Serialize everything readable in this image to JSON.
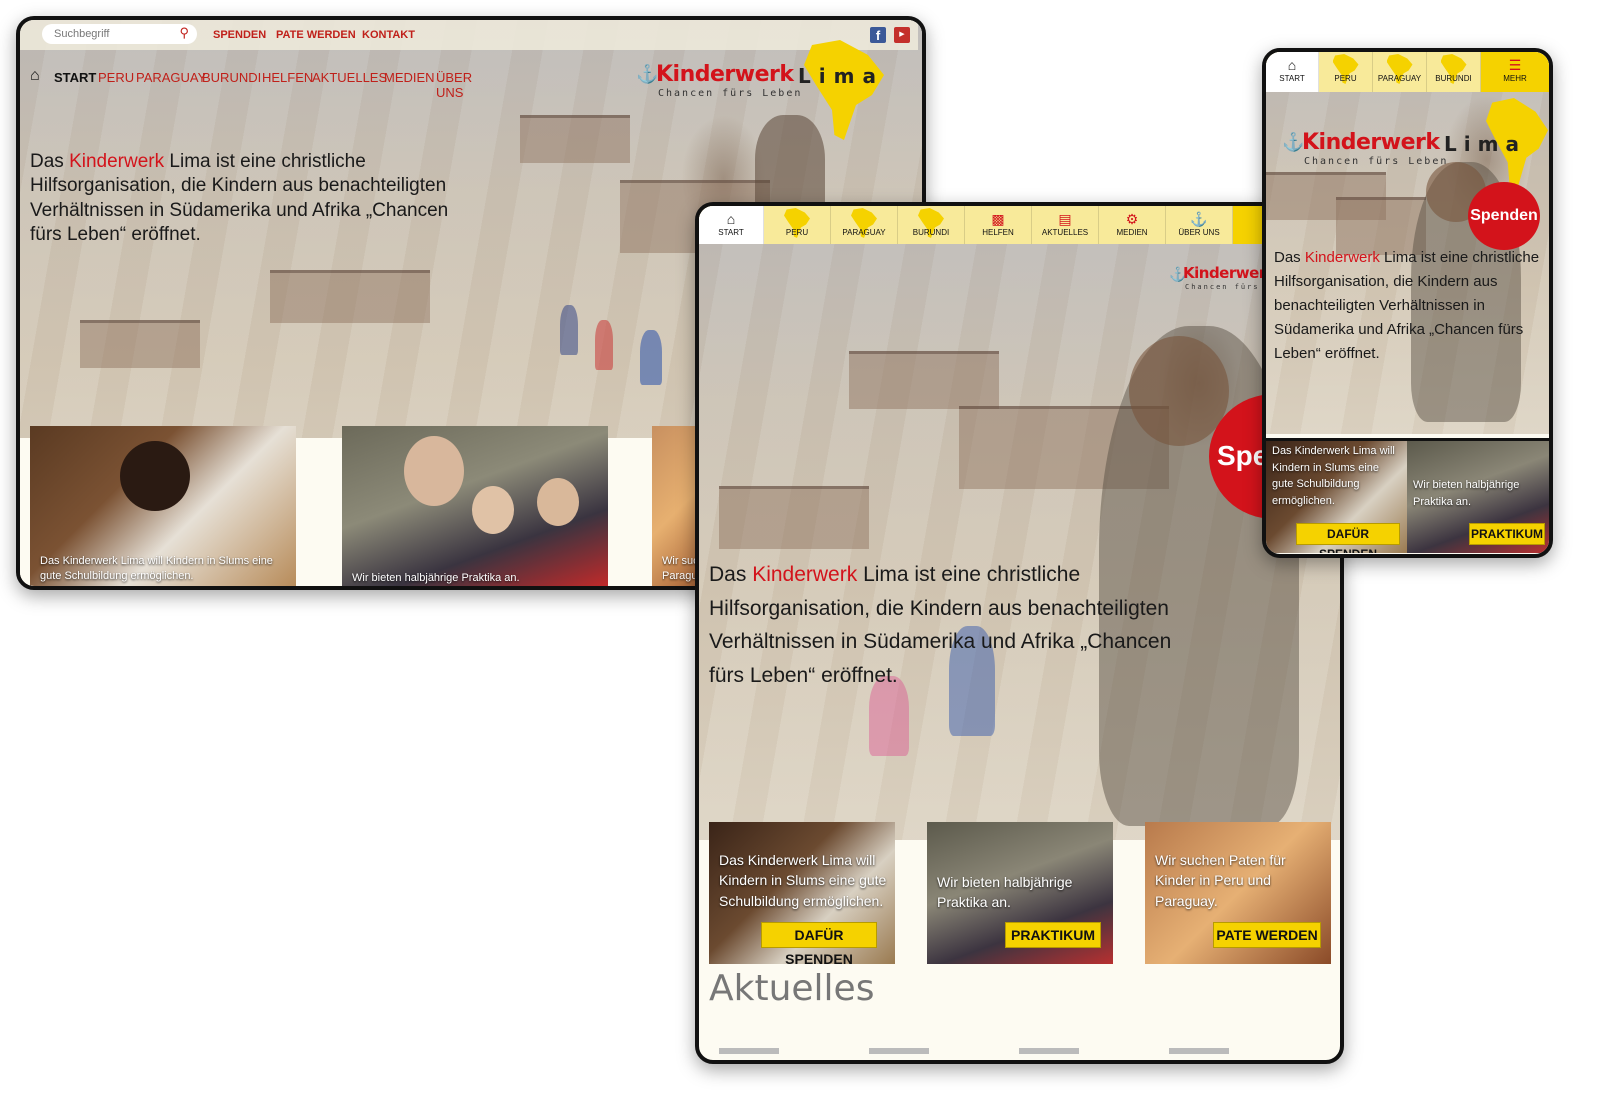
{
  "desktop": {
    "search_placeholder": "Suchbegriff",
    "top_links": [
      "SPENDEN",
      "PATE WERDEN",
      "KONTAKT"
    ],
    "social": [
      "facebook-icon",
      "youtube-icon"
    ],
    "nav": [
      "START",
      "PERU",
      "PARAGUAY",
      "BURUNDI",
      "HELFEN",
      "AKTUELLES",
      "MEDIEN",
      "ÜBER UNS"
    ],
    "logo_main": "Kinderwerk",
    "logo_lima": "Lima",
    "logo_sub": "Chancen fürs Leben",
    "hero_pre": "Das ",
    "hero_red": "Kinderwerk",
    "hero_post": " Lima ist eine christliche Hilfsorganisation, die Kindern aus benachteiligten Verhältnissen in Südamerika und Afrika „Chancen fürs Leben“ eröffnet.",
    "cards": [
      "Das Kinderwerk Lima will Kindern in Slums eine gute Schulbildung ermöglichen.",
      "Wir bieten halbjährige Praktika an.",
      "Wir suc Paragu"
    ]
  },
  "tablet": {
    "tabs": [
      "START",
      "PERU",
      "PARAGUAY",
      "BURUNDI",
      "HELFEN",
      "AKTUELLES",
      "MEDIEN",
      "ÜBER UNS"
    ],
    "logo_main": "Kinderwer",
    "logo_sub": "Chancen fürs Le",
    "spenden_partial": "Spe",
    "hero_pre": "Das ",
    "hero_red": "Kinderwerk",
    "hero_post": " Lima ist eine christliche Hilfsorganisation, die Kindern aus benachteiligten Verhältnissen in Südamerika und Afrika „Chancen fürs Leben“ eröffnet.",
    "cards": [
      {
        "caption": "Das Kinderwerk Lima will Kindern in Slums eine gute Schulbildung ermöglichen.",
        "button": "DAFÜR SPENDEN"
      },
      {
        "caption": "Wir bieten halbjährige Praktika an.",
        "button": "PRAKTIKUM"
      },
      {
        "caption": "Wir suchen Paten für Kinder in Peru und Paraguay.",
        "button": "PATE WERDEN"
      }
    ],
    "section_title": "Aktuelles"
  },
  "phone": {
    "tabs": [
      "START",
      "PERU",
      "PARAGUAY",
      "BURUNDI",
      "MEHR"
    ],
    "logo_main": "Kinderwerk",
    "logo_lima": "Lima",
    "logo_sub": "Chancen fürs Leben",
    "spenden": "Spenden",
    "hero_pre": "Das ",
    "hero_red": "Kinderwerk",
    "hero_post": " Lima ist eine christliche Hilfsorganisation, die Kindern aus benachteiligten Verhältnissen in Südamerika und Afrika „Chancen fürs Leben“ eröffnet.",
    "cards": [
      {
        "caption": "Das Kinderwerk Lima will Kindern in Slums eine gute Schulbildung ermöglichen.",
        "button": "DAFÜR SPENDEN"
      },
      {
        "caption": "Wir bieten halbjährige Praktika an.",
        "button": "PRAKTIKUM"
      }
    ]
  },
  "colors": {
    "brand_red": "#d3131b",
    "brand_yellow": "#f5d200"
  }
}
